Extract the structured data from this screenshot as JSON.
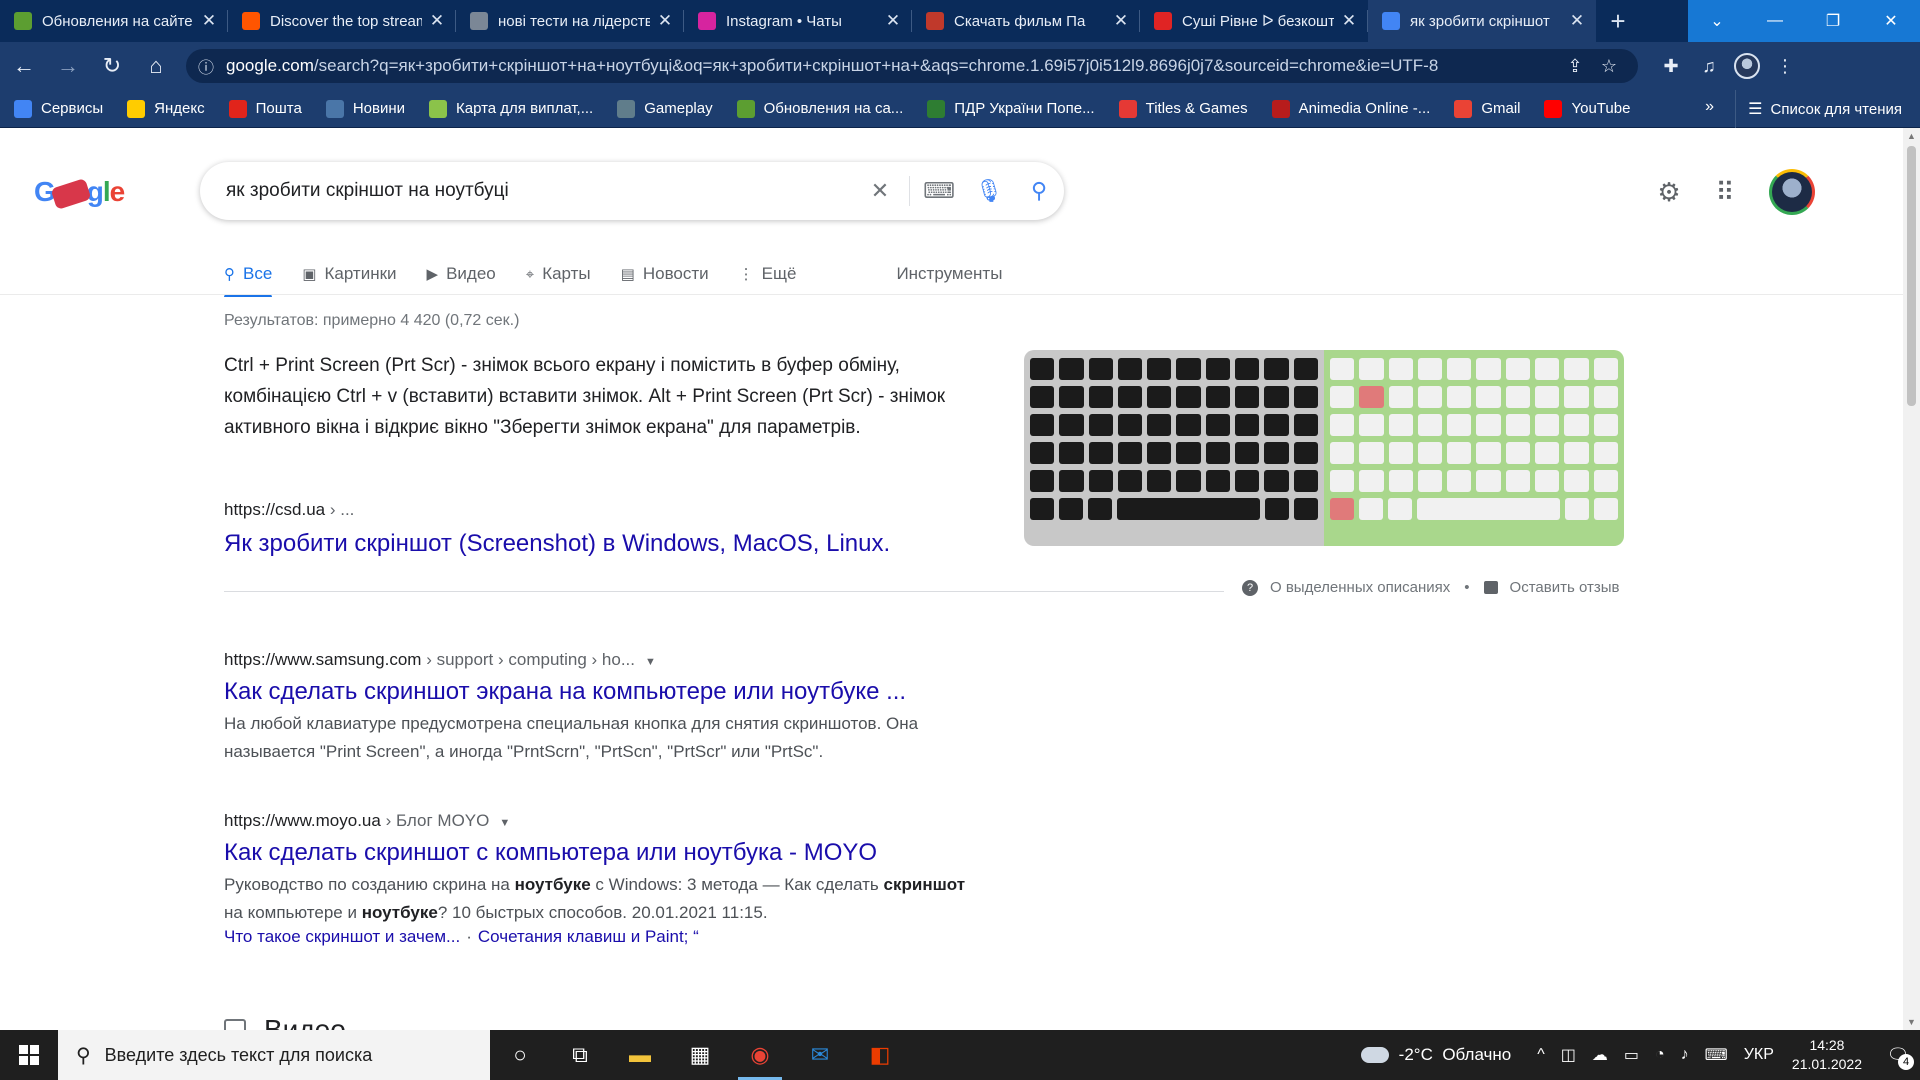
{
  "browser": {
    "tabs": [
      {
        "title": "Обновления на сайте",
        "favicon": "chrome-icon",
        "color": "#5c9e31",
        "active": false
      },
      {
        "title": "Discover the top streamed",
        "favicon": "soundcloud-icon",
        "color": "#ff5500",
        "active": false
      },
      {
        "title": "нові тести на лідерство",
        "favicon": "globe-icon",
        "color": "#7b8796",
        "active": false
      },
      {
        "title": "Instagram • Чаты",
        "favicon": "instagram-icon",
        "color": "#d6249f",
        "active": false
      },
      {
        "title": "Скачать фильм Па",
        "favicon": "film-icon",
        "color": "#c0392b",
        "active": false
      },
      {
        "title": "Суші Рівне ᐅ безкоштовна",
        "favicon": "sushi-icon",
        "color": "#e02424",
        "active": false
      },
      {
        "title": "як зробити скріншот",
        "favicon": "google-icon",
        "color": "#4285f4",
        "active": true
      }
    ],
    "url_host": "google.com",
    "url_rest": "/search?q=як+зробити+скріншот+на+ноутбуці&oq=як+зробити+скріншот+на+&aqs=chrome.1.69i57j0i512l9.8696j0j7&sourceid=chrome&ie=UTF-8"
  },
  "bookmarks": {
    "items": [
      {
        "label": "Сервисы",
        "icon": "apps-grid-icon",
        "color": "#4285f4"
      },
      {
        "label": "Яндекс",
        "icon": "yandex-icon",
        "color": "#ffcc00"
      },
      {
        "label": "Пошта",
        "icon": "opera-icon",
        "color": "#e1241b"
      },
      {
        "label": "Новини",
        "icon": "vk-icon",
        "color": "#4a76a8"
      },
      {
        "label": "Карта для виплат,...",
        "icon": "map-icon",
        "color": "#8bc34a"
      },
      {
        "label": "Gameplay",
        "icon": "gameplay-icon",
        "color": "#607d8b"
      },
      {
        "label": "Обновления на са...",
        "icon": "chrome-icon",
        "color": "#5c9e31"
      },
      {
        "label": "ПДР України Попе...",
        "icon": "traffic-light-icon",
        "color": "#2e7d32"
      },
      {
        "label": "Titles & Games",
        "icon": "r-logo-icon",
        "color": "#e53935"
      },
      {
        "label": "Animedia Online -...",
        "icon": "animedia-icon",
        "color": "#b71c1c"
      },
      {
        "label": "Gmail",
        "icon": "gmail-icon",
        "color": "#ea4335"
      },
      {
        "label": "YouTube",
        "icon": "youtube-icon",
        "color": "#ff0000"
      }
    ],
    "more": "»",
    "reading_list": "Список для чтения"
  },
  "google": {
    "query": "як зробити скріншот на ноутбуці",
    "tabs": [
      "Все",
      "Картинки",
      "Видео",
      "Карты",
      "Новости",
      "Ещё"
    ],
    "tools": "Инструменты",
    "stats": "Результатов: примерно 4 420 (0,72 сек.)"
  },
  "featured": {
    "snippet": "Ctrl + Print Screen (Prt Scr) - знімок всього екрану і помістить в буфер обміну, комбінацією Ctrl + v (вставити) вставити знімок. Alt + Print Screen (Prt Scr) - знімок активного вікна і відкриє вікно \"Зберегти знімок екрана\" для параметрів.",
    "source": "https://csd.ua",
    "source_crumb": " › ...",
    "title": "Як зробити скріншот (Screenshot) в Windows, MacOS, Linux.",
    "about": "О выделенных описаниях",
    "dot": "•",
    "feedback": "Оставить отзыв"
  },
  "results": [
    {
      "source": "https://www.samsung.com",
      "crumb": " › support › computing › ho...",
      "title": "Как сделать скриншот экрана на компьютере или ноутбуке ...",
      "desc": "На любой клавиатуре предусмотрена специальная кнопка для снятия скриншотов. Она называется \"Print Screen\", а иногда \"PrntScrn\", \"PrtScn\", \"PrtScr\" или \"PrtSc\"."
    },
    {
      "source": "https://www.moyo.ua",
      "crumb": " › Блог MOYO",
      "title": "Как сделать скриншот с компьютера или ноутбука - MOYO",
      "desc_parts": [
        "Руководство по созданию скрина на ",
        "ноутбуке",
        " с Windows: 3 метода — Как сделать ",
        "скриншот",
        " на компьютере и ",
        "ноутбуке",
        "? 10 быстрых способов. 20.01.2021 11:15."
      ],
      "sublink1": "Что такое скриншот и зачем...",
      "sublink_sep": "·",
      "sublink2": "Сочетания клавиш и Paint; “"
    }
  ],
  "videos_heading": "Видео",
  "taskbar": {
    "search_placeholder": "Введите здесь текст для поиска",
    "temperature": "-2°C",
    "weather": "Облачно",
    "lang": "УКР",
    "time": "14:28",
    "date": "21.01.2022",
    "notifications": "4"
  }
}
